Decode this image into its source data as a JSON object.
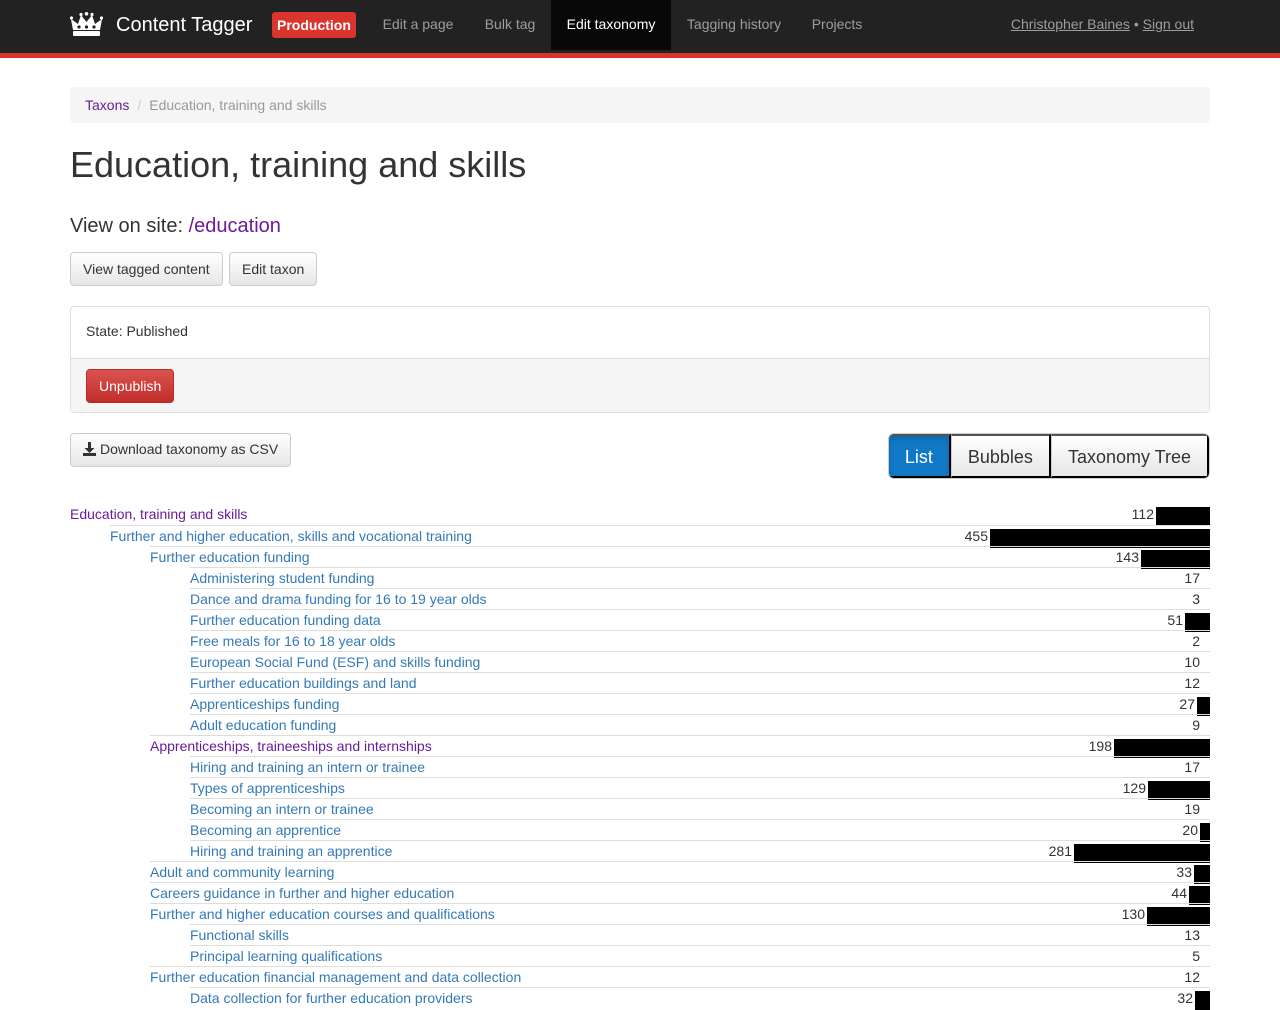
{
  "header": {
    "brand": "Content Tagger",
    "environment": "Production",
    "nav": [
      {
        "label": "Edit a page",
        "active": false
      },
      {
        "label": "Bulk tag",
        "active": false
      },
      {
        "label": "Edit taxonomy",
        "active": true
      },
      {
        "label": "Tagging history",
        "active": false
      },
      {
        "label": "Projects",
        "active": false
      }
    ],
    "user_name": "Christopher Baines",
    "separator": "•",
    "sign_out": "Sign out"
  },
  "breadcrumb": {
    "root": "Taxons",
    "separator": "/",
    "current": "Education, training and skills"
  },
  "page": {
    "title": "Education, training and skills",
    "view_on_site_label": "View on site:",
    "view_on_site_path": "/education",
    "view_tagged_button": "View tagged content",
    "edit_taxon_button": "Edit taxon",
    "state_text": "State: Published",
    "unpublish_button": "Unpublish",
    "download_button": "Download taxonomy as CSV"
  },
  "view_toggle": [
    {
      "label": "List",
      "active": true
    },
    {
      "label": "Bubbles",
      "active": false
    },
    {
      "label": "Taxonomy Tree",
      "active": false
    }
  ],
  "colors": {
    "link": "#337ab7",
    "visited_link": "#6a1b9a",
    "accent_red": "#d9342e",
    "navbar": "#222222",
    "active_toggle": "#1178c5"
  },
  "taxonomy": [
    {
      "name": "Education, training and skills",
      "count": 112,
      "level": 0,
      "visited": true
    },
    {
      "name": "Further and higher education, skills and vocational training",
      "count": 455,
      "level": 1
    },
    {
      "name": "Further education funding",
      "count": 143,
      "level": 2
    },
    {
      "name": "Administering student funding",
      "count": 17,
      "level": 3
    },
    {
      "name": "Dance and drama funding for 16 to 19 year olds",
      "count": 3,
      "level": 3
    },
    {
      "name": "Further education funding data",
      "count": 51,
      "level": 3
    },
    {
      "name": "Free meals for 16 to 18 year olds",
      "count": 2,
      "level": 3
    },
    {
      "name": "European Social Fund (ESF) and skills funding",
      "count": 10,
      "level": 3
    },
    {
      "name": "Further education buildings and land",
      "count": 12,
      "level": 3
    },
    {
      "name": "Apprenticeships funding",
      "count": 27,
      "level": 3
    },
    {
      "name": "Adult education funding",
      "count": 9,
      "level": 3
    },
    {
      "name": "Apprenticeships, traineeships and internships",
      "count": 198,
      "level": 2,
      "visited": true
    },
    {
      "name": "Hiring and training an intern or trainee",
      "count": 17,
      "level": 3
    },
    {
      "name": "Types of apprenticeships",
      "count": 129,
      "level": 3
    },
    {
      "name": "Becoming an intern or trainee",
      "count": 19,
      "level": 3
    },
    {
      "name": "Becoming an apprentice",
      "count": 20,
      "level": 3
    },
    {
      "name": "Hiring and training an apprentice",
      "count": 281,
      "level": 3
    },
    {
      "name": "Adult and community learning",
      "count": 33,
      "level": 2
    },
    {
      "name": "Careers guidance in further and higher education",
      "count": 44,
      "level": 2
    },
    {
      "name": "Further and higher education courses and qualifications",
      "count": 130,
      "level": 2
    },
    {
      "name": "Functional skills",
      "count": 13,
      "level": 3
    },
    {
      "name": "Principal learning qualifications",
      "count": 5,
      "level": 3
    },
    {
      "name": "Further education financial management and data collection",
      "count": 12,
      "level": 2
    },
    {
      "name": "Data collection for further education providers",
      "count": 32,
      "level": 3
    }
  ]
}
